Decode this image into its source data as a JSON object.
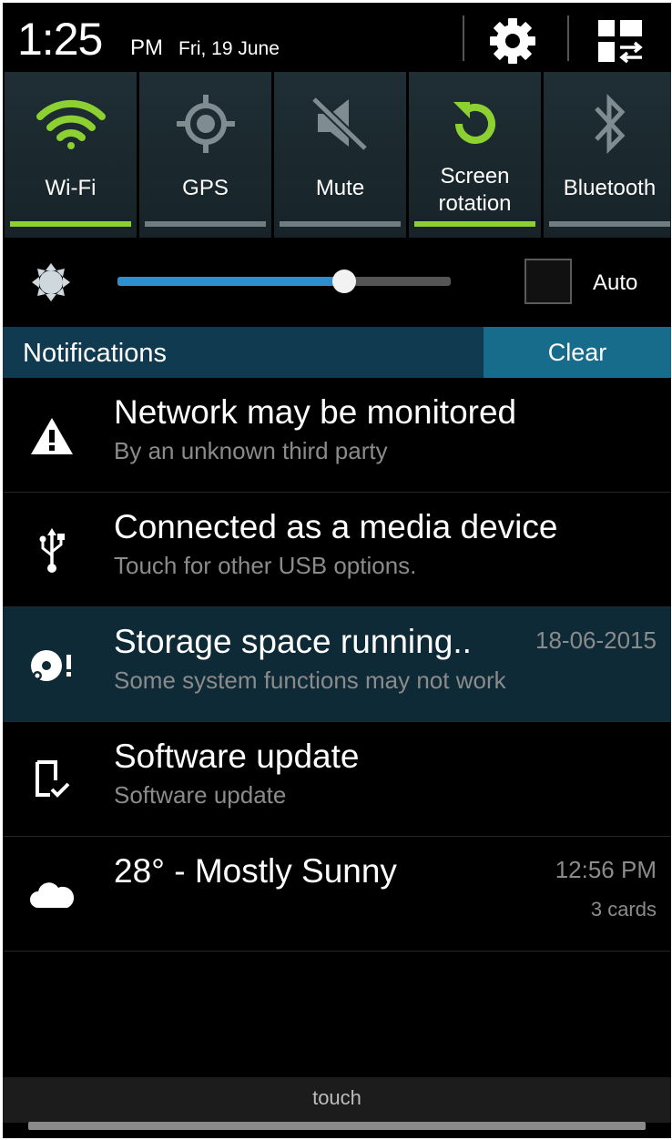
{
  "status": {
    "time": "1:25",
    "ampm": "PM",
    "date": "Fri, 19 June"
  },
  "toggles": [
    {
      "label": "Wi-Fi",
      "icon": "wifi-icon",
      "on": true
    },
    {
      "label": "GPS",
      "icon": "gps-icon",
      "on": false
    },
    {
      "label": "Mute",
      "icon": "mute-icon",
      "on": false
    },
    {
      "label_line1": "Screen",
      "label_line2": "rotation",
      "icon": "rotation-icon",
      "on": true
    },
    {
      "label": "Bluetooth",
      "icon": "bluetooth-icon",
      "on": false
    }
  ],
  "brightness": {
    "level": 0.68,
    "auto_label": "Auto",
    "auto_checked": false
  },
  "notifications_header": {
    "title": "Notifications",
    "clear_label": "Clear"
  },
  "notifications": [
    {
      "title": "Network may be monitored",
      "subtitle": "By an unknown third party",
      "icon": "warning-icon"
    },
    {
      "title": "Connected as a media device",
      "subtitle": "Touch for other USB options.",
      "icon": "usb-icon"
    },
    {
      "title": "Storage space running..",
      "subtitle": "Some system functions may not work",
      "time": "18-06-2015",
      "icon": "storage-warning-icon"
    },
    {
      "title": "Software update",
      "subtitle": "Software update",
      "icon": "software-update-icon"
    },
    {
      "title": "28° - Mostly Sunny",
      "time": "12:56 PM",
      "meta": "3 cards",
      "icon": "cloud-icon"
    }
  ],
  "bottom": {
    "touch_label": "touch"
  },
  "colors": {
    "accent_green": "#8cd131",
    "brightness_blue": "#2d8fd0",
    "clear_button": "#176c8c",
    "header_bg": "#0f3a4f"
  }
}
